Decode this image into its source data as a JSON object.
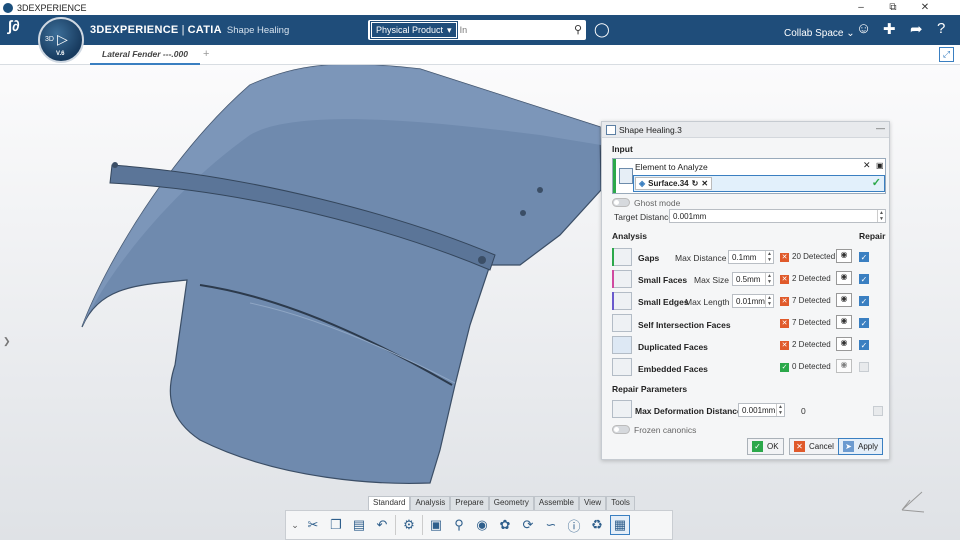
{
  "window": {
    "title": "3DEXPERIENCE"
  },
  "header": {
    "brand": "3DEXPERIENCE",
    "product": "CATIA",
    "app_name": "Shape Healing",
    "compass_3d": "3D",
    "compass_version": "V.6",
    "search_scope": "Physical Product",
    "search_placeholder": "In",
    "collab_space": "Collab Space"
  },
  "tabs": {
    "active_doc": "Lateral Fender ---.000",
    "add": "+"
  },
  "panel": {
    "title": "Shape Healing.3",
    "input_section": "Input",
    "element_label": "Element to Analyze",
    "element_value": "Surface.34",
    "ghost_mode": "Ghost mode",
    "target_distance_label": "Target Distance",
    "target_distance_value": "0.001mm",
    "analysis_section": "Analysis",
    "repair_header": "Repair",
    "rows": [
      {
        "name": "Gaps",
        "param_label": "Max Distance :",
        "param_value": "0.1mm",
        "status": "error",
        "result": "20 Detected",
        "repair": true
      },
      {
        "name": "Small Faces",
        "param_label": "Max Size :",
        "param_value": "0.5mm",
        "status": "error",
        "result": "2 Detected",
        "repair": true
      },
      {
        "name": "Small Edges",
        "param_label": "Max Length :",
        "param_value": "0.01mm",
        "status": "error",
        "result": "7 Detected",
        "repair": true
      },
      {
        "name": "Self Intersection Faces",
        "status": "error",
        "result": "7 Detected",
        "repair": true
      },
      {
        "name": "Duplicated Faces",
        "status": "error",
        "result": "2 Detected",
        "repair": true
      },
      {
        "name": "Embedded Faces",
        "status": "ok",
        "result": "0 Detected",
        "repair": false
      }
    ],
    "repair_params_section": "Repair Parameters",
    "max_deformation_label": "Max Deformation Distance :",
    "max_deformation_value": "0.001mm",
    "max_deformation_result": "0",
    "frozen_canonics": "Frozen canonics",
    "ok_label": "OK",
    "cancel_label": "Cancel",
    "apply_label": "Apply"
  },
  "command_tabs": [
    "Standard",
    "Analysis",
    "Prepare",
    "Geometry",
    "Assemble",
    "View",
    "Tools"
  ],
  "colors": {
    "header": "#1f4d7a",
    "accent": "#3a7fc1",
    "error": "#e05a2b",
    "ok": "#2ba84a",
    "model": "#6c87aa"
  }
}
